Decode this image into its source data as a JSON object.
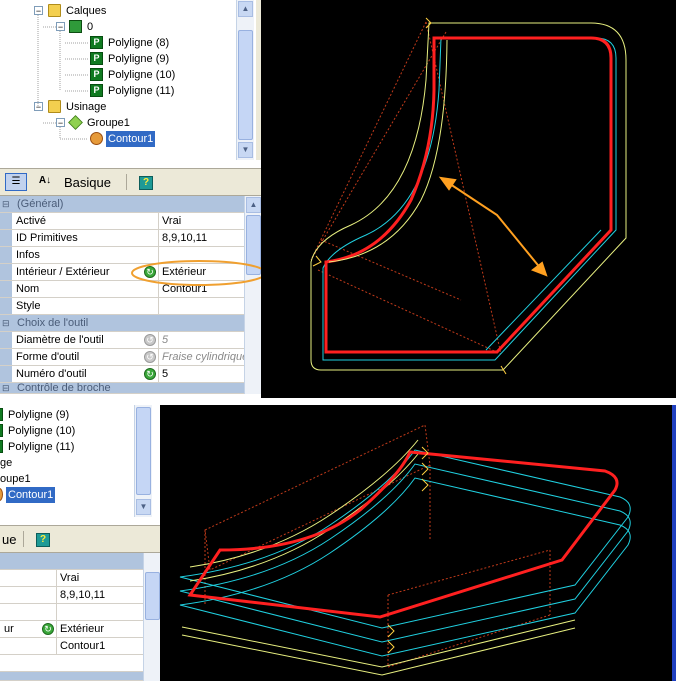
{
  "top_tree": {
    "items": [
      {
        "label": "Calques"
      },
      {
        "label": "0"
      },
      {
        "label": "Polyligne (8)"
      },
      {
        "label": "Polyligne (9)"
      },
      {
        "label": "Polyligne (10)"
      },
      {
        "label": "Polyligne (11)"
      },
      {
        "label": "Usinage"
      },
      {
        "label": "Groupe1"
      },
      {
        "label": "Contour1"
      }
    ]
  },
  "top_toolbar": {
    "view_label": "Basique",
    "help_label": "?"
  },
  "top_grid": {
    "categories": {
      "general": "(Général)",
      "tool": "Choix de l'outil",
      "spindle": "Contrôle de broche"
    },
    "rows": [
      {
        "name": "Activé",
        "value": "Vrai"
      },
      {
        "name": "ID Primitives",
        "value": "8,9,10,11"
      },
      {
        "name": "Infos",
        "value": ""
      },
      {
        "name": "Intérieur / Extérieur",
        "value": "Extérieur"
      },
      {
        "name": "Nom",
        "value": "Contour1"
      },
      {
        "name": "Style",
        "value": ""
      },
      {
        "name": "Diamètre de l'outil",
        "value": "5"
      },
      {
        "name": "Forme d'outil",
        "value": "Fraise cylindrique"
      },
      {
        "name": "Numéro d'outil",
        "value": "5"
      }
    ]
  },
  "bottom_tree": {
    "items": [
      {
        "label": "Polyligne (9)"
      },
      {
        "label": "Polyligne (10)"
      },
      {
        "label": "Polyligne (11)"
      },
      {
        "label": "ge"
      },
      {
        "label": "oupe1"
      },
      {
        "label": "Contour1"
      }
    ]
  },
  "bottom_toolbar": {
    "view_label_partial": "ue",
    "help_label": "?"
  },
  "bottom_grid": {
    "rows": [
      {
        "name": "",
        "value": "Vrai"
      },
      {
        "name": "",
        "value": "8,9,10,11"
      },
      {
        "name": "",
        "value": ""
      },
      {
        "name": "ur",
        "value": "Extérieur"
      },
      {
        "name": "",
        "value": "Contour1"
      }
    ]
  },
  "colors": {
    "accent": "#316ac5",
    "highlight_ellipse": "#f0a030",
    "contour_red": "#ff2020",
    "offset_cyan": "#20d0e0",
    "offset_yellow": "#e8f080",
    "arrow_orange": "#ffa020"
  }
}
